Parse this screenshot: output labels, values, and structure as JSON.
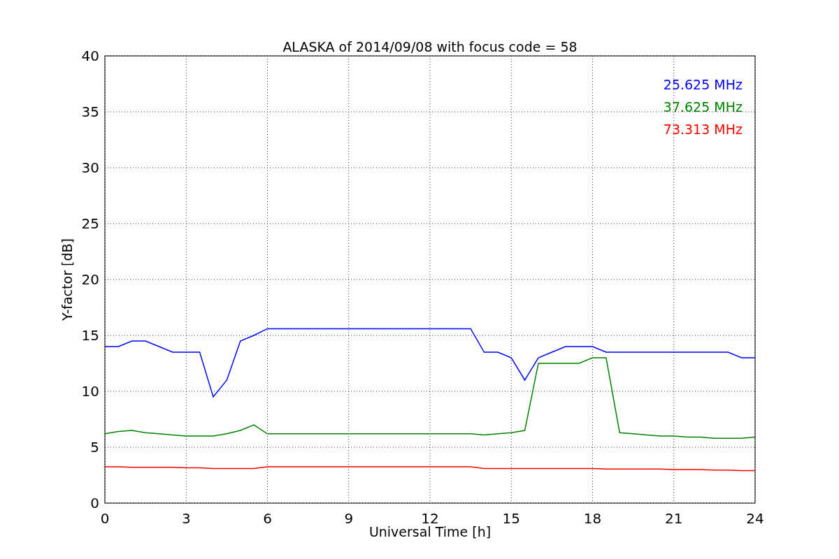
{
  "figure": {
    "chart_data": {
      "type": "line",
      "title": "ALASKA of 2014/09/08 with focus code = 58",
      "xlabel": "Universal Time [h]",
      "ylabel": "Y-factor [dB]",
      "x": [
        0,
        0.5,
        1,
        1.5,
        2,
        2.5,
        3,
        3.5,
        4,
        4.5,
        5,
        5.5,
        6,
        6.5,
        7,
        7.5,
        8,
        8.5,
        9,
        9.5,
        10,
        10.5,
        11,
        11.5,
        12,
        12.5,
        13,
        13.5,
        14,
        14.5,
        15,
        15.5,
        16,
        16.5,
        17,
        17.5,
        18,
        18.5,
        19,
        19.5,
        20,
        20.5,
        21,
        21.5,
        22,
        22.5,
        23,
        23.5,
        24
      ],
      "series": [
        {
          "name": "25.625 MHz",
          "color": "#0000ff",
          "values": [
            14,
            14,
            14.5,
            14.5,
            14,
            13.5,
            13.5,
            13.5,
            9.5,
            11,
            14.5,
            15,
            15.6,
            15.6,
            15.6,
            15.6,
            15.6,
            15.6,
            15.6,
            15.6,
            15.6,
            15.6,
            15.6,
            15.6,
            15.6,
            15.6,
            15.6,
            15.6,
            13.5,
            13.5,
            13,
            11,
            13,
            13.5,
            14,
            14,
            14,
            13.5,
            13.5,
            13.5,
            13.5,
            13.5,
            13.5,
            13.5,
            13.5,
            13.5,
            13.5,
            13,
            13
          ]
        },
        {
          "name": "37.625 MHz",
          "color": "#008000",
          "values": [
            6.2,
            6.4,
            6.5,
            6.3,
            6.2,
            6.1,
            6,
            6,
            6,
            6.2,
            6.5,
            7,
            6.2,
            6.2,
            6.2,
            6.2,
            6.2,
            6.2,
            6.2,
            6.2,
            6.2,
            6.2,
            6.2,
            6.2,
            6.2,
            6.2,
            6.2,
            6.2,
            6.1,
            6.2,
            6.3,
            6.5,
            12.5,
            12.5,
            12.5,
            12.5,
            13,
            13,
            6.3,
            6.2,
            6.1,
            6,
            6,
            5.9,
            5.9,
            5.8,
            5.8,
            5.8,
            5.9
          ]
        },
        {
          "name": "73.313 MHz",
          "color": "#ff0000",
          "values": [
            3.25,
            3.25,
            3.2,
            3.2,
            3.2,
            3.2,
            3.15,
            3.15,
            3.1,
            3.1,
            3.1,
            3.1,
            3.25,
            3.25,
            3.25,
            3.25,
            3.25,
            3.25,
            3.25,
            3.25,
            3.25,
            3.25,
            3.25,
            3.25,
            3.25,
            3.25,
            3.25,
            3.25,
            3.1,
            3.1,
            3.1,
            3.1,
            3.1,
            3.1,
            3.1,
            3.1,
            3.1,
            3.05,
            3.05,
            3.05,
            3.05,
            3.05,
            3.0,
            3.0,
            3.0,
            2.95,
            2.95,
            2.9,
            2.9
          ]
        }
      ],
      "grid": true,
      "xlim": [
        0,
        24
      ],
      "ylim": [
        0,
        40
      ],
      "xticks": [
        0,
        3,
        6,
        9,
        12,
        15,
        18,
        21,
        24
      ],
      "yticks": [
        0,
        5,
        10,
        15,
        20,
        25,
        30,
        35,
        40
      ]
    }
  }
}
